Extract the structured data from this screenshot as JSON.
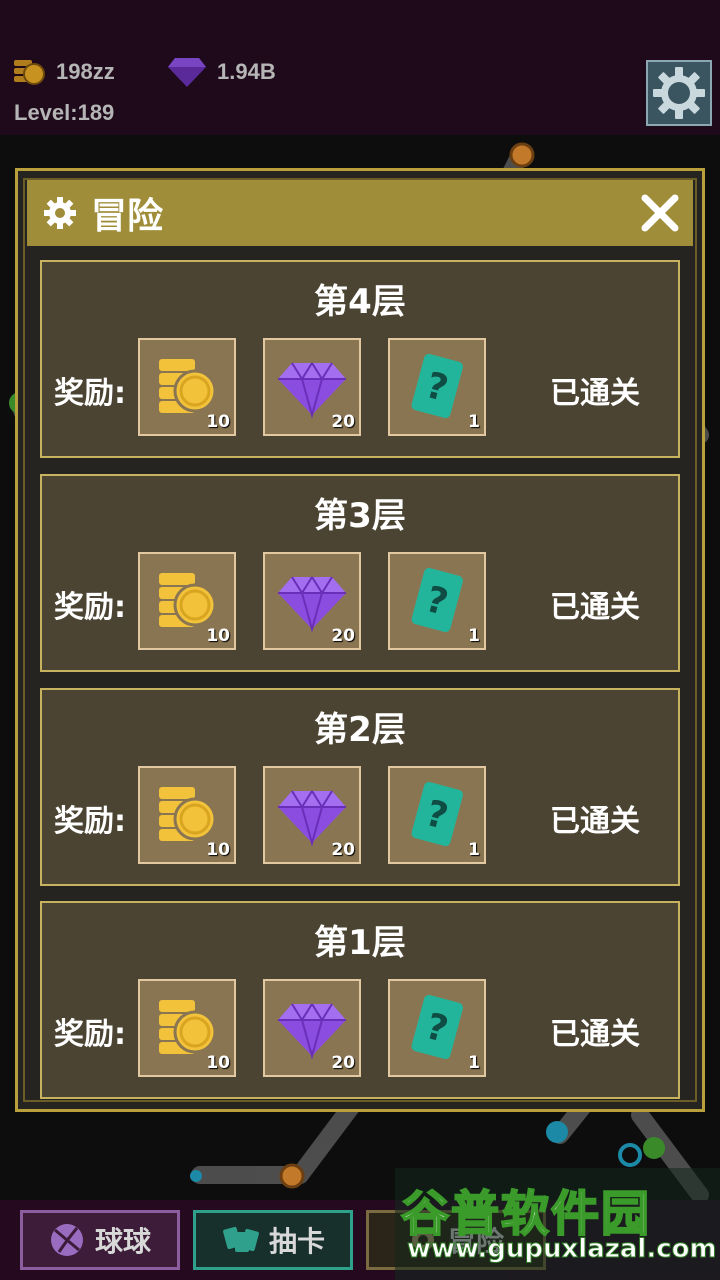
{
  "hud": {
    "coins": "198zz",
    "gems": "1.94B",
    "level": "Level:189"
  },
  "modal": {
    "title": "冒险",
    "reward_label": "奖励:",
    "levels": [
      {
        "title": "第4层",
        "coins": "10",
        "gems": "20",
        "cards": "1",
        "status": "已通关"
      },
      {
        "title": "第3层",
        "coins": "10",
        "gems": "20",
        "cards": "1",
        "status": "已通关"
      },
      {
        "title": "第2层",
        "coins": "10",
        "gems": "20",
        "cards": "1",
        "status": "已通关"
      },
      {
        "title": "第1层",
        "coins": "10",
        "gems": "20",
        "cards": "1",
        "status": "已通关"
      }
    ]
  },
  "nav": {
    "balls": "球球",
    "draw": "抽卡",
    "third": "冒险"
  },
  "watermark": {
    "title": "谷普软件园",
    "url": "www.gupuxlazal.com"
  },
  "colors": {
    "accent_gold": "#9f8d3a",
    "card_bg": "#4b4433",
    "coin": "#f2c23a",
    "gem": "#8b4de0",
    "card_icon": "#23b59b"
  },
  "icons": [
    "coin-stack-icon",
    "diamond-icon",
    "gear-icon",
    "close-icon",
    "mystery-card-icon",
    "ball-icon",
    "cards-icon"
  ]
}
